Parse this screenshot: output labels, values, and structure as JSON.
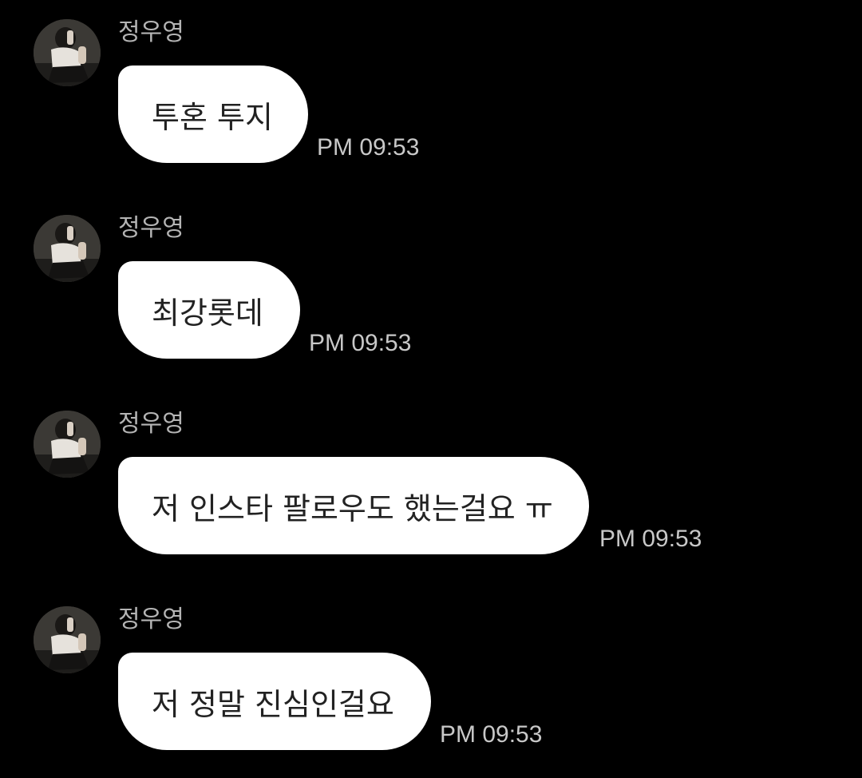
{
  "messages": [
    {
      "sender": "정우영",
      "text": "투혼 투지",
      "time": "PM 09:53"
    },
    {
      "sender": "정우영",
      "text": "최강롯데",
      "time": "PM 09:53"
    },
    {
      "sender": "정우영",
      "text": "저 인스타 팔로우도 했는걸요 ㅠ",
      "time": "PM 09:53"
    },
    {
      "sender": "정우영",
      "text": "저 정말 진심인걸요",
      "time": "PM 09:53"
    }
  ]
}
